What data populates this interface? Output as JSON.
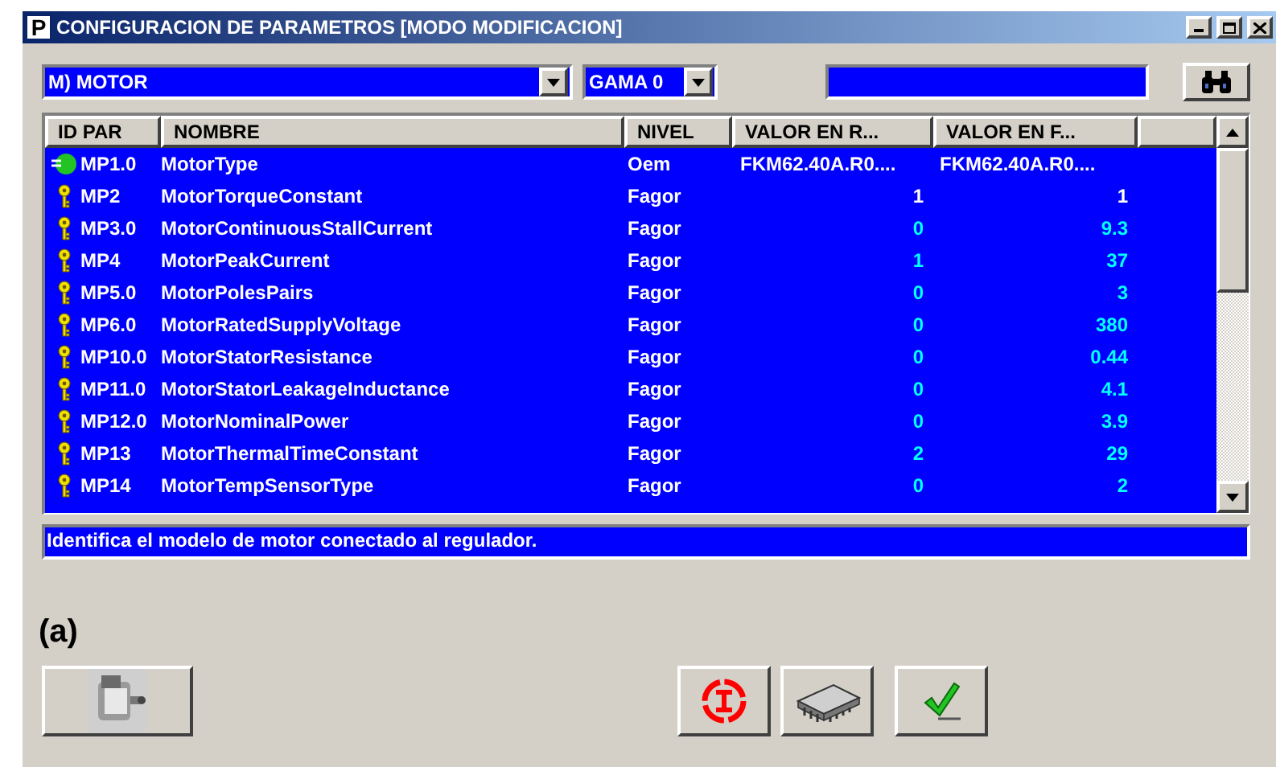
{
  "window": {
    "title": "CONFIGURACION DE PARAMETROS [MODO MODIFICACION]",
    "app_icon": "P"
  },
  "group_select": {
    "value": "M) MOTOR"
  },
  "range_select": {
    "value": "GAMA 0"
  },
  "table": {
    "columns": [
      "ID PAR",
      "NOMBRE",
      "NIVEL",
      "VALOR EN R...",
      "VALOR EN F..."
    ],
    "rows": [
      {
        "kind": "oem",
        "id": "MP1.0",
        "name": "MotorType",
        "level": "Oem",
        "value_r": "FKM62.40A.R0....",
        "value_f": "FKM62.40A.R0....",
        "color": "#ffffff"
      },
      {
        "kind": "key",
        "id": "MP2",
        "name": "MotorTorqueConstant",
        "level": "Fagor",
        "value_r": "1",
        "value_f": "1",
        "color": "#ffffff"
      },
      {
        "kind": "key",
        "id": "MP3.0",
        "name": "MotorContinuousStallCurrent",
        "level": "Fagor",
        "value_r": "0",
        "value_f": "9.3",
        "color": "#00ffff"
      },
      {
        "kind": "key",
        "id": "MP4",
        "name": "MotorPeakCurrent",
        "level": "Fagor",
        "value_r": "1",
        "value_f": "37",
        "color": "#00ffff"
      },
      {
        "kind": "key",
        "id": "MP5.0",
        "name": "MotorPolesPairs",
        "level": "Fagor",
        "value_r": "0",
        "value_f": "3",
        "color": "#00ffff"
      },
      {
        "kind": "key",
        "id": "MP6.0",
        "name": "MotorRatedSupplyVoltage",
        "level": "Fagor",
        "value_r": "0",
        "value_f": "380",
        "color": "#00ffff"
      },
      {
        "kind": "key",
        "id": "MP10.0",
        "name": "MotorStatorResistance",
        "level": "Fagor",
        "value_r": "0",
        "value_f": "0.44",
        "color": "#00ffff"
      },
      {
        "kind": "key",
        "id": "MP11.0",
        "name": "MotorStatorLeakageInductance",
        "level": "Fagor",
        "value_r": "0",
        "value_f": "4.1",
        "color": "#00ffff"
      },
      {
        "kind": "key",
        "id": "MP12.0",
        "name": "MotorNominalPower",
        "level": "Fagor",
        "value_r": "0",
        "value_f": "3.9",
        "color": "#00ffff"
      },
      {
        "kind": "key",
        "id": "MP13",
        "name": "MotorThermalTimeConstant",
        "level": "Fagor",
        "value_r": "2",
        "value_f": "29",
        "color": "#00ffff"
      },
      {
        "kind": "key",
        "id": "MP14",
        "name": "MotorTempSensorType",
        "level": "Fagor",
        "value_r": "0",
        "value_f": "2",
        "color": "#00ffff"
      }
    ]
  },
  "description": "Identifica el modelo de motor conectado al regulador.",
  "caption": "(a)",
  "buttons": [
    {
      "kind": "motor"
    },
    {
      "kind": "stop"
    },
    {
      "kind": "chip"
    },
    {
      "kind": "ok"
    }
  ]
}
